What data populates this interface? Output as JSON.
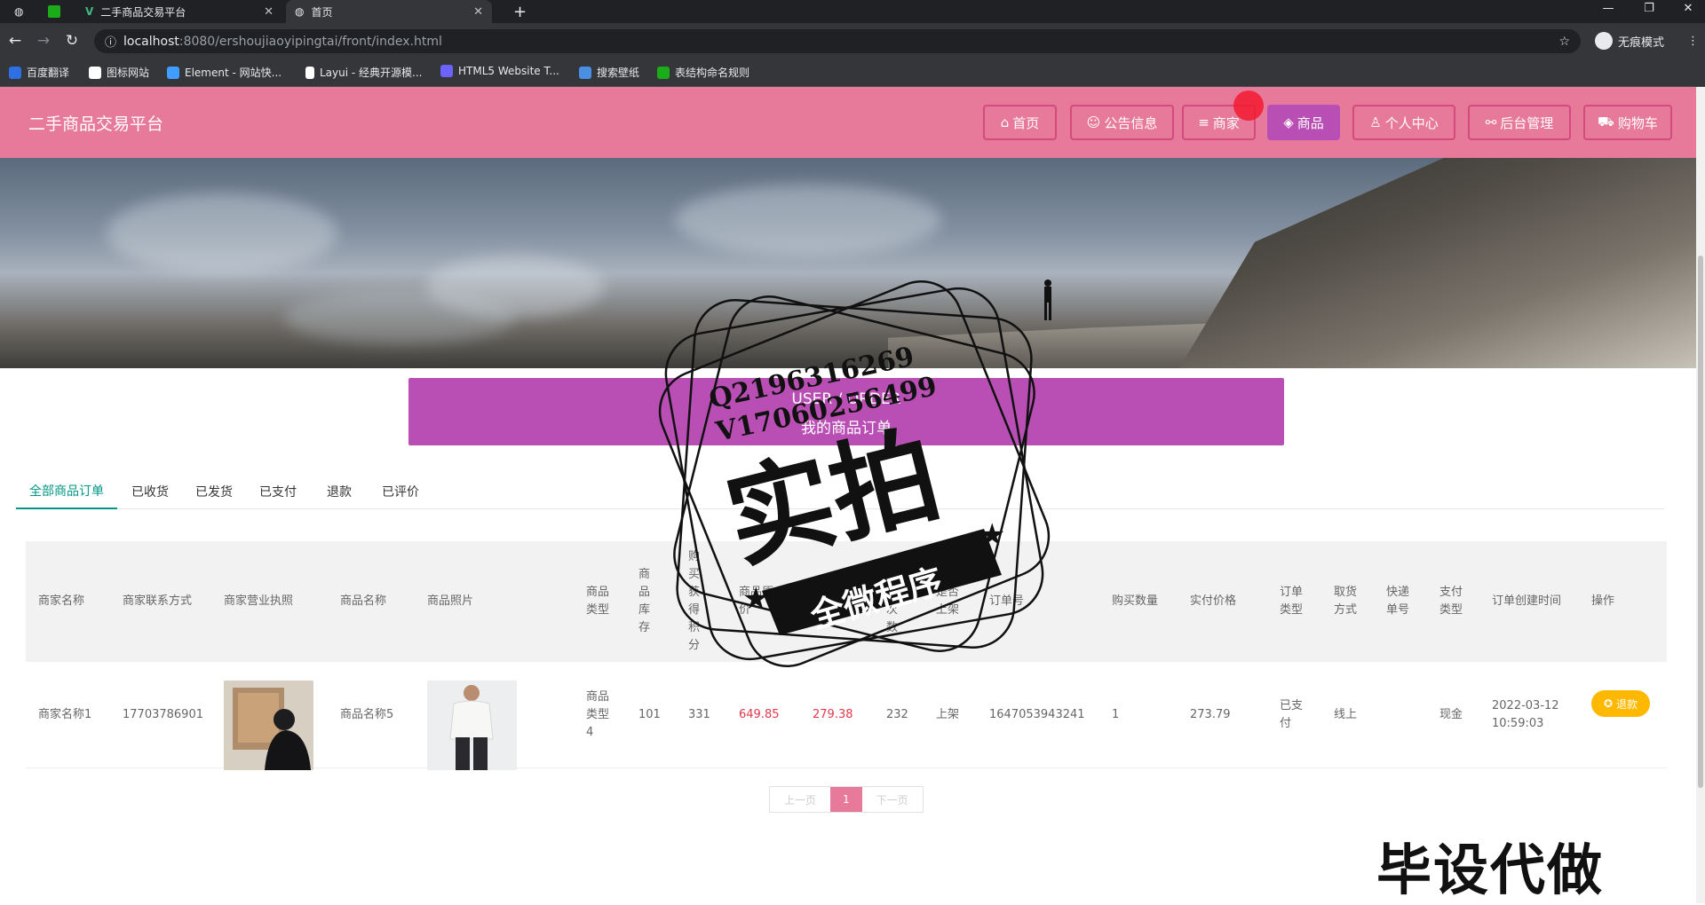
{
  "browser": {
    "tabs": [
      {
        "title": ""
      },
      {
        "title": ""
      },
      {
        "title": "二手商品交易平台"
      },
      {
        "title": "首页"
      }
    ],
    "url_host": "localhost",
    "url_path": ":8080/ershoujiaoyipingtai/front/index.html",
    "profile_label": "无痕模式",
    "bookmarks": [
      {
        "label": "百度翻译",
        "color": "#2f6fe4"
      },
      {
        "label": "图标网站",
        "color": "#ffffff"
      },
      {
        "label": "Element - 网站快...",
        "color": "#409eff"
      },
      {
        "label": "Layui - 经典开源模...",
        "color": "#ffffff"
      },
      {
        "label": "HTML5 Website T...",
        "color": "#6c63ff"
      },
      {
        "label": "搜索壁纸",
        "color": "#4a90e2"
      },
      {
        "label": "表结构命名规则",
        "color": "#1aad19"
      }
    ]
  },
  "header": {
    "site_title": "二手商品交易平台",
    "nav": [
      {
        "label": "首页",
        "icon": "home-icon",
        "glyph": "⌂",
        "active": false
      },
      {
        "label": "公告信息",
        "icon": "notice-icon",
        "glyph": "☺",
        "active": false
      },
      {
        "label": "商家",
        "icon": "shop-icon",
        "glyph": "≡",
        "active": false
      },
      {
        "label": "商品",
        "icon": "goods-icon",
        "glyph": "◈",
        "active": true
      },
      {
        "label": "个人中心",
        "icon": "user-icon",
        "glyph": "♙",
        "active": false
      },
      {
        "label": "后台管理",
        "icon": "link-icon",
        "glyph": "⚯",
        "active": false
      },
      {
        "label": "购物车",
        "icon": "cart-icon",
        "glyph": "⛟",
        "active": false
      }
    ],
    "colors": {
      "bar": "#e7799b",
      "active": "#b94fb4"
    }
  },
  "section": {
    "title_en": "USER / ORDER",
    "title_cn": "我的商品订单"
  },
  "order_tabs": [
    {
      "label": "全部商品订单",
      "active": true
    },
    {
      "label": "已收货",
      "active": false
    },
    {
      "label": "已发货",
      "active": false
    },
    {
      "label": "已支付",
      "active": false
    },
    {
      "label": "退款",
      "active": false
    },
    {
      "label": "已评价",
      "active": false
    }
  ],
  "table": {
    "columns": [
      "商家名称",
      "商家联系方式",
      "商家营业执照",
      "商品名称",
      "商品照片",
      "商品类型",
      "商品库存",
      "购买获得积分",
      "商品原价",
      "现价",
      "点击次数",
      "是否上架",
      "订单号",
      "购买数量",
      "实付价格",
      "订单类型",
      "取货方式",
      "快递单号",
      "支付类型",
      "订单创建时间",
      "操作"
    ],
    "rows": [
      {
        "shop_name": "商家名称1",
        "shop_phone": "17703786901",
        "goods_name": "商品名称5",
        "goods_type": "商品类型4",
        "stock": "101",
        "points": "331",
        "original_price": "649.85",
        "current_price": "279.38",
        "clicks": "232",
        "on_shelf": "上架",
        "order_no": "1647053943241",
        "qty": "1",
        "paid": "273.79",
        "order_type": "已支付",
        "pickup": "线上",
        "express_no": "",
        "pay_type": "现金",
        "created": "2022-03-12 10:59:03",
        "action": "退款"
      }
    ]
  },
  "pager": {
    "prev": "上一页",
    "current": "1",
    "next": "下一页"
  },
  "watermark": {
    "line1": "Q2196316269",
    "line2": "V17060256499",
    "big": "实拍",
    "ribbon": "全微程序",
    "corner": "毕设代做"
  }
}
